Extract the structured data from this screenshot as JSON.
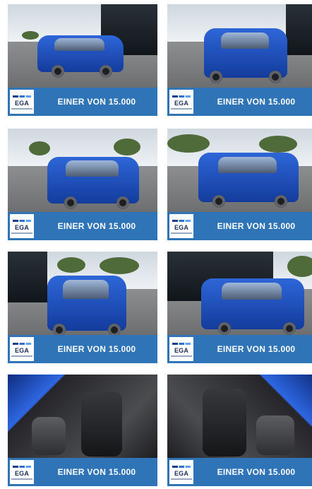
{
  "tiles": [
    {
      "slogan": "EINER VON 15.000",
      "logo_text": "EGA",
      "photo": "front-left"
    },
    {
      "slogan": "EINER VON 15.000",
      "logo_text": "EGA",
      "photo": "front"
    },
    {
      "slogan": "EINER VON 15.000",
      "logo_text": "EGA",
      "photo": "front-left-2"
    },
    {
      "slogan": "EINER VON 15.000",
      "logo_text": "EGA",
      "photo": "rear-right"
    },
    {
      "slogan": "EINER VON 15.000",
      "logo_text": "EGA",
      "photo": "rear"
    },
    {
      "slogan": "EINER VON 15.000",
      "logo_text": "EGA",
      "photo": "rear-left"
    },
    {
      "slogan": "EINER VON 15.000",
      "logo_text": "EGA",
      "photo": "interior-driver"
    },
    {
      "slogan": "EINER VON 15.000",
      "logo_text": "EGA",
      "photo": "interior-passenger"
    }
  ],
  "colors": {
    "banner": "#2f74b6",
    "car": "#2e66d8",
    "logo_text": "#1b2b5a"
  }
}
